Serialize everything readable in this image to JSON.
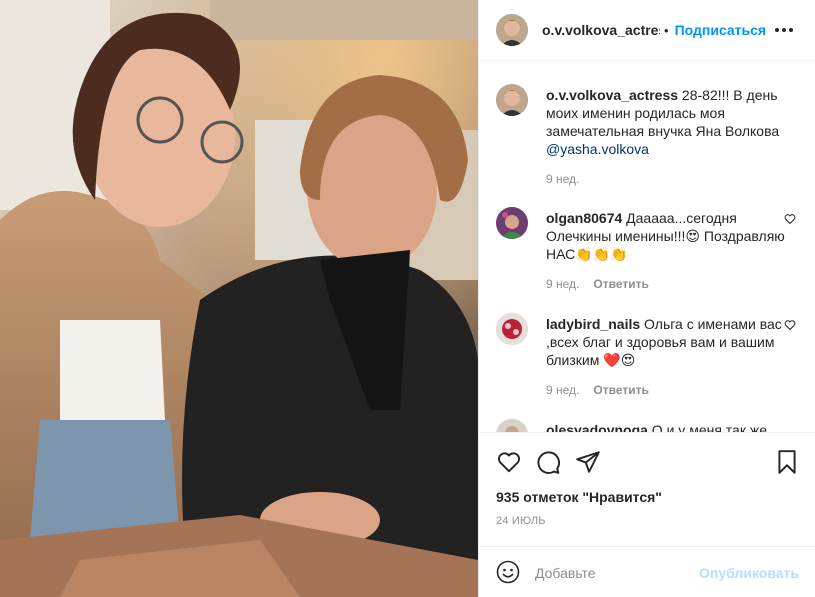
{
  "post": {
    "author": "o.v.volkova_actress",
    "follow_label": "Подписаться",
    "separator": "•"
  },
  "comments": [
    {
      "username": "o.v.volkova_actress",
      "text": " 28-82!!! В день моих именин родилась моя замечательная внучка Яна Волкова ",
      "mention": "@yasha.volkova",
      "time": "9 нед.",
      "reply_label": ""
    },
    {
      "username": "olgan80674",
      "text": " Дааааа...сегодня Олечкины именины!!!😍 Поздравляю НАС👏👏👏",
      "time": "9 нед.",
      "reply_label": "Ответить"
    },
    {
      "username": "ladybird_nails",
      "text": " Ольга с именами вас ,всех благ и здоровья вам и вашим близким ❤️😍",
      "time": "9 нед.",
      "reply_label": "Ответить"
    },
    {
      "username": "olesyadovnoga",
      "text": " О и у меня так же"
    }
  ],
  "stats": {
    "likes": "935 отметок \"Нравится\"",
    "date": "24 ИЮЛЬ"
  },
  "composer": {
    "placeholder": "Добавьте",
    "publish_label": "Опубликовать"
  },
  "colors": {
    "accent": "#0095f6",
    "publish_disabled": "#b2dffc",
    "muted": "#8e8e8e",
    "border": "#efefef"
  }
}
